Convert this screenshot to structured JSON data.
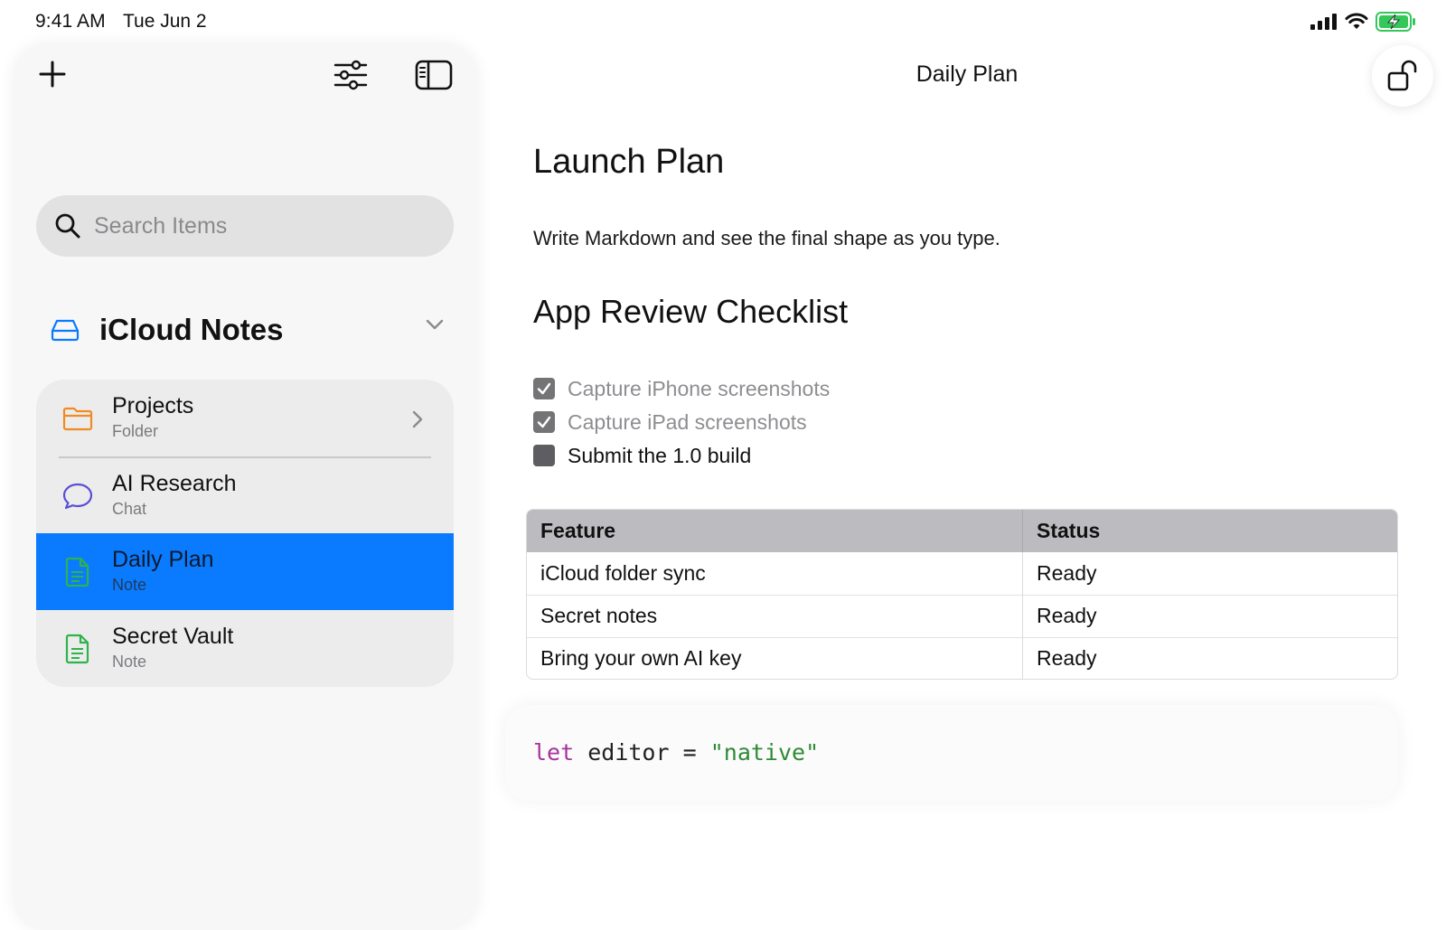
{
  "status_bar": {
    "time": "9:41 AM",
    "date": "Tue Jun 2",
    "icons": [
      "cellular-signal-icon",
      "wifi-icon",
      "battery-charging-icon"
    ]
  },
  "sidebar": {
    "toolbar": {
      "icons": [
        "plus-icon",
        "sliders-icon",
        "sidebar-toggle-icon"
      ]
    },
    "search": {
      "placeholder": "Search Items",
      "value": ""
    },
    "section": {
      "title": "iCloud Notes",
      "icon": "drive-icon"
    },
    "items": [
      {
        "title": "Projects",
        "subtitle": "Folder",
        "icon": "folder-icon",
        "color": "#f08a24"
      },
      {
        "title": "AI Research",
        "subtitle": "Chat",
        "icon": "chat-bubble-icon",
        "color": "#5a4fd6"
      },
      {
        "title": "Daily Plan",
        "subtitle": "Note",
        "icon": "note-icon",
        "color": "#2fb34a",
        "selected": true
      },
      {
        "title": "Secret Vault",
        "subtitle": "Note",
        "icon": "note-icon",
        "color": "#2fb34a"
      }
    ]
  },
  "document": {
    "title": "Daily Plan",
    "heading1": "Launch Plan",
    "paragraph": "Write Markdown and see the final shape as you type.",
    "heading2": "App Review Checklist",
    "checklist": [
      {
        "text": "Capture iPhone screenshots",
        "done": true
      },
      {
        "text": "Capture iPad screenshots",
        "done": true
      },
      {
        "text": "Submit the 1.0 build",
        "done": false
      }
    ],
    "table": {
      "headers": [
        "Feature",
        "Status"
      ],
      "rows": [
        [
          "iCloud folder sync",
          "Ready"
        ],
        [
          "Secret notes",
          "Ready"
        ],
        [
          "Bring your own AI key",
          "Ready"
        ]
      ]
    },
    "code": {
      "keyword": "let",
      "identifier": "editor",
      "operator": "=",
      "string": "\"native\""
    }
  },
  "colors": {
    "accent": "#0a7bff",
    "folder": "#f08a24",
    "chat": "#5a4fd6",
    "note": "#2fb34a",
    "drive": "#0a7bff",
    "battery": "#34c759"
  }
}
